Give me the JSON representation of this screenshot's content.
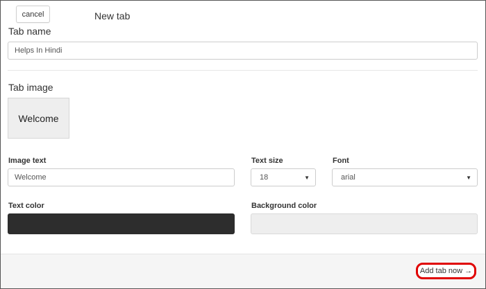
{
  "header": {
    "cancel_label": "cancel",
    "title": "New tab"
  },
  "tab_name": {
    "label": "Tab name",
    "value": "Helps In Hindi"
  },
  "tab_image": {
    "label": "Tab image",
    "preview_text": "Welcome"
  },
  "image_text": {
    "label": "Image text",
    "value": "Welcome"
  },
  "text_size": {
    "label": "Text size",
    "selected": "18"
  },
  "font": {
    "label": "Font",
    "selected": "arial"
  },
  "text_color": {
    "label": "Text color",
    "value": "#2d2d2d"
  },
  "background_color": {
    "label": "Background color",
    "value": "#eeeeee"
  },
  "footer": {
    "add_tab_label": "Add tab now →",
    "highlight_color": "#e00000"
  }
}
